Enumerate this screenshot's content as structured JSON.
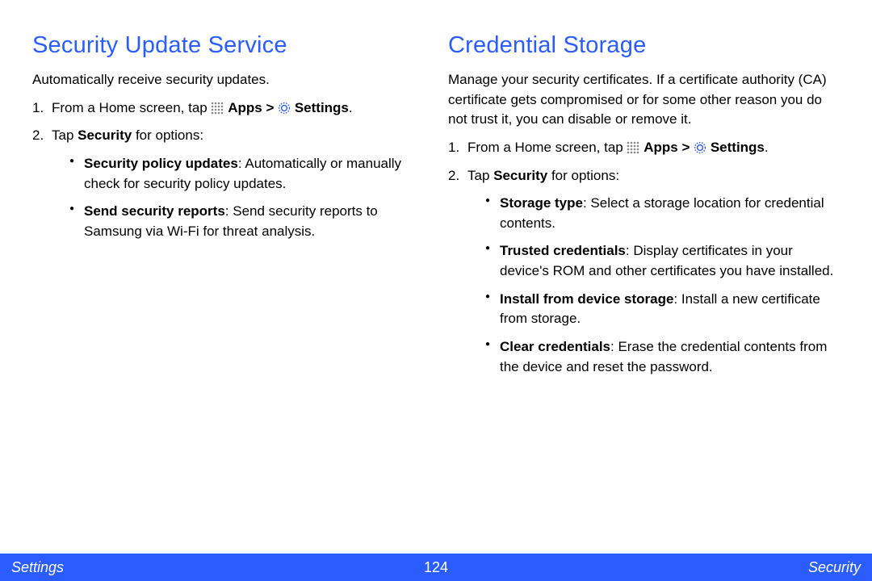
{
  "left": {
    "heading": "Security Update Service",
    "intro": "Automatically receive security updates.",
    "step1_a": "From a Home screen, tap ",
    "step1_apps": "Apps",
    "step1_gt": " > ",
    "step1_settings": "Settings",
    "step1_end": ".",
    "step2_a": "Tap ",
    "step2_b": "Security",
    "step2_c": " for options:",
    "bullets": {
      "spu_t": "Security policy updates",
      "spu_d": ": Automatically or manually check for security policy updates.",
      "ssr_t": "Send security reports",
      "ssr_d": ": Send security reports to Samsung via Wi-Fi for threat analysis."
    }
  },
  "right": {
    "heading": "Credential Storage",
    "intro": "Manage your security certificates. If a certificate authority (CA) certificate gets compromised or for some other reason you do not trust it, you can disable or remove it.",
    "step1_a": "From a Home screen, tap ",
    "step1_apps": "Apps",
    "step1_gt": " > ",
    "step1_settings": "Settings",
    "step1_end": ".",
    "step2_a": "Tap ",
    "step2_b": "Security",
    "step2_c": " for options:",
    "bullets": {
      "st_t": "Storage type",
      "st_d": ": Select a storage location for credential contents.",
      "tc_t": "Trusted credentials",
      "tc_d": ": Display certificates in your device's ROM and other certificates you have installed.",
      "ifs_t": "Install from device storage",
      "ifs_d": ": Install a new certificate from storage.",
      "cc_t": "Clear credentials",
      "cc_d": ": Erase the credential contents from the device and reset the password."
    }
  },
  "footer": {
    "left": "Settings",
    "page": "124",
    "right": "Security"
  }
}
